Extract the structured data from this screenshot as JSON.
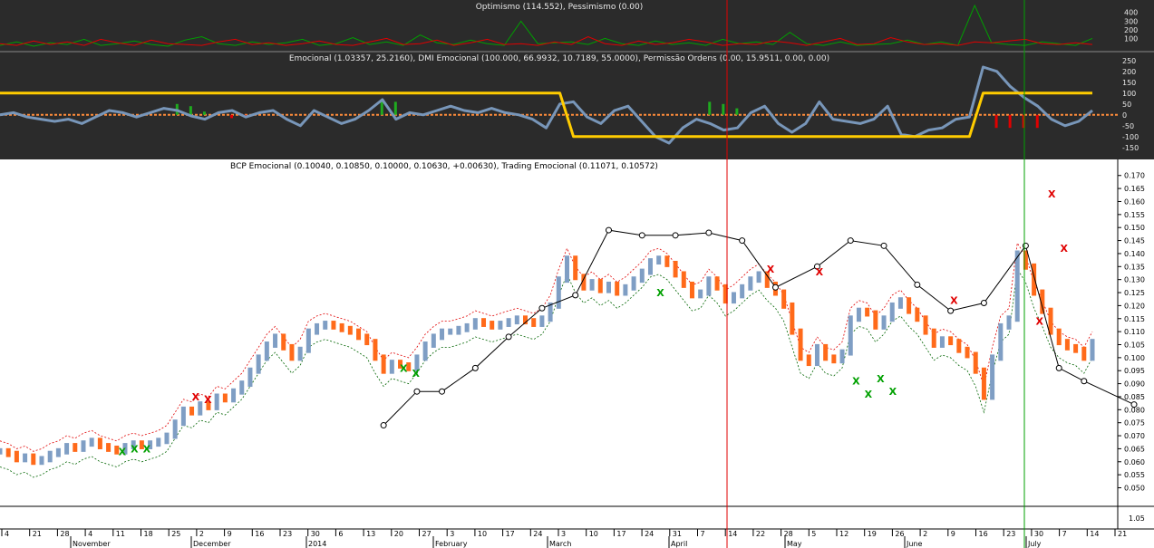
{
  "panels": {
    "optimism_title": "Optimismo (114.552), Pessimismo (0.00)",
    "emotional_title": "Emocional (1.03357, 25.2160), DMI Emocional (100.000, 66.9932, 10.7189, 55.0000), Permissão Ordens (0.00, 15.9511, 0.00, 0.00)",
    "price_title": "BCP Emocional (0.10040, 0.10850, 0.10000, 0.10630, +0.00630), Trading Emocional (0.11071, 0.10572)"
  },
  "colors": {
    "dark_bg": "#2b2b2b",
    "bull": "#7f9ec4",
    "bear": "#ff6a1a",
    "red_line": "#e00000",
    "green_line": "#00a000",
    "yellow": "#ffcc00",
    "osc": "#7896b9"
  },
  "chart_data": [
    {
      "type": "line",
      "title": "Optimismo (114.552), Pessimismo (0.00)",
      "yticks": [
        "400",
        "300",
        "200",
        "100"
      ],
      "ylim": [
        0,
        480
      ],
      "series": [
        {
          "name": "Optimismo",
          "color": "#00a000",
          "values": [
            20,
            60,
            10,
            50,
            30,
            90,
            20,
            40,
            70,
            30,
            10,
            80,
            120,
            40,
            20,
            60,
            30,
            50,
            90,
            20,
            40,
            110,
            30,
            60,
            20,
            140,
            50,
            30,
            80,
            40,
            20,
            300,
            40,
            50,
            60,
            30,
            100,
            40,
            20,
            70,
            30,
            50,
            20,
            90,
            40,
            60,
            30,
            170,
            40,
            20,
            60,
            20,
            30,
            40,
            80,
            30,
            60,
            20,
            480,
            50,
            30,
            20,
            60,
            40,
            20,
            100
          ]
        },
        {
          "name": "Pessimismo",
          "color": "#e00000",
          "values": [
            40,
            20,
            70,
            30,
            60,
            20,
            90,
            50,
            20,
            80,
            40,
            30,
            20,
            60,
            90,
            30,
            50,
            20,
            40,
            70,
            30,
            20,
            60,
            100,
            30,
            40,
            80,
            20,
            50,
            90,
            30,
            40,
            20,
            60,
            30,
            120,
            40,
            20,
            70,
            30,
            50,
            90,
            60,
            20,
            40,
            30,
            70,
            50,
            20,
            60,
            100,
            30,
            40,
            110,
            60,
            30,
            40,
            20,
            60,
            50,
            70,
            90,
            40,
            30,
            50,
            30
          ]
        }
      ]
    },
    {
      "type": "line",
      "title": "Emocional (1.03357, 25.2160), DMI Emocional (100.000, 66.9932, 10.7189, 55.0000), Permissão Ordens (0.00, 15.9511, 0.00, 0.00)",
      "yticks": [
        "250",
        "200",
        "150",
        "100",
        "50",
        "0",
        "-50",
        "-100",
        "-150"
      ],
      "ylim": [
        -180,
        270
      ],
      "series": [
        {
          "name": "Emocional",
          "color": "#7896b9",
          "values": [
            0,
            10,
            -10,
            -20,
            -30,
            -20,
            -40,
            -10,
            20,
            10,
            -10,
            10,
            30,
            20,
            -5,
            -20,
            10,
            20,
            -10,
            10,
            20,
            -20,
            -50,
            20,
            -10,
            -40,
            -20,
            20,
            70,
            -20,
            10,
            0,
            20,
            40,
            20,
            10,
            30,
            10,
            0,
            -20,
            -60,
            50,
            60,
            -10,
            -40,
            20,
            40,
            -30,
            -100,
            -130,
            -60,
            -20,
            -40,
            -70,
            -60,
            10,
            40,
            -40,
            -80,
            -40,
            60,
            -20,
            -30,
            -40,
            -20,
            40,
            -90,
            -100,
            -70,
            -60,
            -20,
            -10,
            220,
            200,
            130,
            80,
            40,
            -20,
            -50,
            -30,
            20
          ]
        },
        {
          "name": "DMI Emocional",
          "color": "#ffcc00",
          "values": [
            100,
            100,
            100,
            100,
            100,
            100,
            100,
            100,
            100,
            100,
            100,
            100,
            100,
            100,
            100,
            100,
            100,
            100,
            100,
            100,
            100,
            100,
            100,
            100,
            100,
            100,
            100,
            100,
            100,
            100,
            100,
            100,
            100,
            100,
            100,
            100,
            100,
            100,
            100,
            100,
            100,
            100,
            -100,
            -100,
            -100,
            -100,
            -100,
            -100,
            -100,
            -100,
            -100,
            -100,
            -100,
            -100,
            -100,
            -100,
            -100,
            -100,
            -100,
            -100,
            -100,
            -100,
            -100,
            -100,
            -100,
            -100,
            -100,
            -100,
            -100,
            -100,
            -100,
            -100,
            100,
            100,
            100,
            100,
            100,
            100,
            100,
            100,
            100
          ]
        }
      ],
      "histogram": [
        0,
        0,
        0,
        0,
        0,
        0,
        0,
        0,
        0,
        0,
        0,
        0,
        0,
        50,
        40,
        15,
        0,
        -15,
        -10,
        0,
        0,
        0,
        0,
        0,
        0,
        0,
        0,
        0,
        60,
        60,
        0,
        0,
        0,
        0,
        0,
        0,
        0,
        0,
        0,
        0,
        0,
        0,
        0,
        0,
        0,
        0,
        0,
        0,
        0,
        0,
        0,
        0,
        60,
        50,
        30,
        0,
        0,
        0,
        0,
        0,
        0,
        0,
        0,
        0,
        0,
        0,
        0,
        0,
        0,
        0,
        0,
        0,
        0,
        -60,
        -60,
        -60,
        -60,
        0,
        0,
        0,
        0
      ]
    },
    {
      "type": "line",
      "title": "BCP Emocional (0.10040, 0.10850, 0.10000, 0.10630, +0.00630), Trading Emocional (0.11071, 0.10572)",
      "ylabel": "",
      "ylim": [
        0.046,
        0.172
      ],
      "yticks": [
        "0.170",
        "0.165",
        "0.160",
        "0.155",
        "0.150",
        "0.145",
        "0.140",
        "0.135",
        "0.130",
        "0.125",
        "0.120",
        "0.115",
        "0.110",
        "0.105",
        "0.100",
        "0.095",
        "0.090",
        "0.085",
        "0.080",
        "0.075",
        "0.070",
        "0.065",
        "0.060",
        "0.055",
        "0.050"
      ],
      "lower_tick": "1.05",
      "x_ticks": [
        "4",
        "21",
        "28",
        "4",
        "11",
        "18",
        "25",
        "2",
        "9",
        "16",
        "23",
        "30",
        "6",
        "13",
        "20",
        "27",
        "3",
        "10",
        "17",
        "24",
        "3",
        "10",
        "17",
        "24",
        "31",
        "7",
        "14",
        "22",
        "28",
        "5",
        "12",
        "19",
        "26",
        "2",
        "9",
        "16",
        "23",
        "30",
        "7",
        "14",
        "21"
      ],
      "months": [
        "November",
        "December",
        "2014",
        "February",
        "March",
        "April",
        "May",
        "June",
        "July"
      ],
      "series": [
        {
          "name": "BCP Emocional",
          "values": [
            0.064,
            0.063,
            0.061,
            0.062,
            0.06,
            0.061,
            0.063,
            0.064,
            0.066,
            0.065,
            0.067,
            0.068,
            0.066,
            0.065,
            0.064,
            0.066,
            0.067,
            0.066,
            0.067,
            0.068,
            0.07,
            0.075,
            0.08,
            0.079,
            0.082,
            0.081,
            0.085,
            0.084,
            0.087,
            0.09,
            0.095,
            0.1,
            0.105,
            0.108,
            0.104,
            0.1,
            0.103,
            0.11,
            0.112,
            0.113,
            0.112,
            0.111,
            0.11,
            0.108,
            0.106,
            0.1,
            0.095,
            0.098,
            0.097,
            0.096,
            0.1,
            0.105,
            0.108,
            0.11,
            0.11,
            0.111,
            0.112,
            0.114,
            0.113,
            0.112,
            0.113,
            0.114,
            0.115,
            0.114,
            0.113,
            0.115,
            0.12,
            0.13,
            0.138,
            0.131,
            0.127,
            0.129,
            0.126,
            0.128,
            0.125,
            0.127,
            0.13,
            0.133,
            0.137,
            0.138,
            0.136,
            0.132,
            0.128,
            0.124,
            0.125,
            0.13,
            0.127,
            0.122,
            0.124,
            0.127,
            0.13,
            0.132,
            0.128,
            0.125,
            0.12,
            0.11,
            0.1,
            0.098,
            0.104,
            0.1,
            0.099,
            0.102,
            0.115,
            0.118,
            0.117,
            0.112,
            0.115,
            0.12,
            0.122,
            0.118,
            0.115,
            0.11,
            0.105,
            0.107,
            0.106,
            0.103,
            0.101,
            0.095,
            0.085,
            0.1,
            0.112,
            0.115,
            0.14,
            0.135,
            0.125,
            0.118,
            0.11,
            0.106,
            0.104,
            0.103,
            0.1,
            0.106
          ]
        },
        {
          "name": "Trading Emocional",
          "color": "#000000",
          "x_index": [
            46,
            50,
            53,
            57,
            61,
            65,
            69,
            73,
            77,
            81,
            85,
            89,
            93,
            98,
            102,
            106,
            110,
            114,
            118,
            123,
            127,
            130,
            136,
            140
          ],
          "values": [
            0.074,
            0.087,
            0.087,
            0.096,
            0.108,
            0.119,
            0.124,
            0.149,
            0.147,
            0.147,
            0.148,
            0.145,
            0.127,
            0.135,
            0.145,
            0.143,
            0.128,
            0.118,
            0.121,
            0.143,
            0.096,
            0.091,
            0.082
          ]
        }
      ],
      "x_markers": [
        {
          "label": "X",
          "color": "#e00000",
          "index": 16,
          "value": 0.085
        },
        {
          "label": "X",
          "color": "#e00000",
          "index": 17,
          "value": 0.084
        },
        {
          "label": "X",
          "color": "#e00000",
          "index": 63,
          "value": 0.134
        },
        {
          "label": "X",
          "color": "#e00000",
          "index": 67,
          "value": 0.133
        },
        {
          "label": "X",
          "color": "#e00000",
          "index": 78,
          "value": 0.122
        },
        {
          "label": "X",
          "color": "#e00000",
          "index": 85,
          "value": 0.114
        },
        {
          "label": "X",
          "color": "#e00000",
          "index": 86,
          "value": 0.163
        },
        {
          "label": "X",
          "color": "#e00000",
          "index": 87,
          "value": 0.142
        },
        {
          "label": "X",
          "color": "#00a000",
          "index": 10,
          "value": 0.064
        },
        {
          "label": "X",
          "color": "#00a000",
          "index": 11,
          "value": 0.065
        },
        {
          "label": "X",
          "color": "#00a000",
          "index": 12,
          "value": 0.065
        },
        {
          "label": "X",
          "color": "#00a000",
          "index": 33,
          "value": 0.096
        },
        {
          "label": "X",
          "color": "#00a000",
          "index": 34,
          "value": 0.094
        },
        {
          "label": "X",
          "color": "#00a000",
          "index": 54,
          "value": 0.125
        },
        {
          "label": "X",
          "color": "#00a000",
          "index": 70,
          "value": 0.091
        },
        {
          "label": "X",
          "color": "#00a000",
          "index": 71,
          "value": 0.086
        },
        {
          "label": "X",
          "color": "#00a000",
          "index": 72,
          "value": 0.092
        },
        {
          "label": "X",
          "color": "#00a000",
          "index": 73,
          "value": 0.087
        }
      ]
    }
  ]
}
